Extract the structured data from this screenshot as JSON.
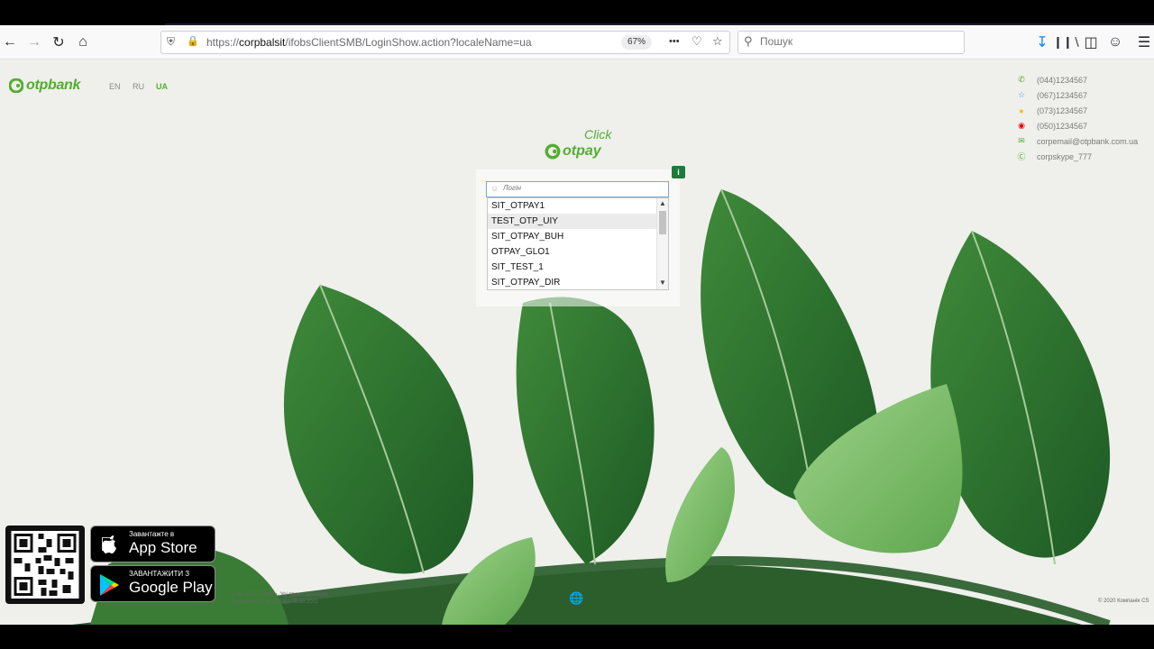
{
  "browser": {
    "url_prefix": "https://",
    "url_domain": "corpbalsit",
    "url_path": "/ifobsClientSMB/LoginShow.action?localeName=ua",
    "zoom": "67%",
    "search_placeholder": "Пошук",
    "menu_dots": "•••"
  },
  "header": {
    "logo_text": "otpbank",
    "languages": [
      "EN",
      "RU",
      "UA"
    ],
    "active_language": "UA"
  },
  "contacts": [
    {
      "icon": "phone-icon",
      "text": "(044)1234567",
      "color": "#52ae30"
    },
    {
      "icon": "kyivstar-icon",
      "text": "(067)1234567",
      "color": "#2aa7e0"
    },
    {
      "icon": "lifecell-icon",
      "text": "(073)1234567",
      "color": "#f2c200"
    },
    {
      "icon": "vodafone-icon",
      "text": "(050)1234567",
      "color": "#e60000"
    },
    {
      "icon": "mail-icon",
      "text": "corpemail@otpbank.com.ua",
      "color": "#52ae30"
    },
    {
      "icon": "skype-icon",
      "text": "corpskype_777",
      "color": "#52ae30"
    }
  ],
  "brand": {
    "click_text": "Click",
    "otpay_text": "otpay"
  },
  "login": {
    "info_label": "i",
    "placeholder": "Логін",
    "options": [
      "SIT_OTPAY1",
      "TEST_OTP_UIY",
      "SIT_OTPAY_BUH",
      "OTPAY_GLO1",
      "SIT_TEST_1",
      "SIT_OTPAY_DIR"
    ],
    "hovered_index": 1
  },
  "apps": {
    "appstore_small": "Завантажте в",
    "appstore_big": "App Store",
    "googleplay_small": "ЗАВАНТАЖИТИ З",
    "googleplay_big": "Google Play"
  },
  "footer": {
    "legal_line1": "© АТ «ОТП БАНК». Усі права захищені",
    "legal_line2": "Ліцензія НБУ № 191 від 05.10.2011",
    "copyright": "© 2020 Компанія CS"
  },
  "colors": {
    "brand_green": "#52ae30",
    "dark_green": "#1f7a3a"
  }
}
